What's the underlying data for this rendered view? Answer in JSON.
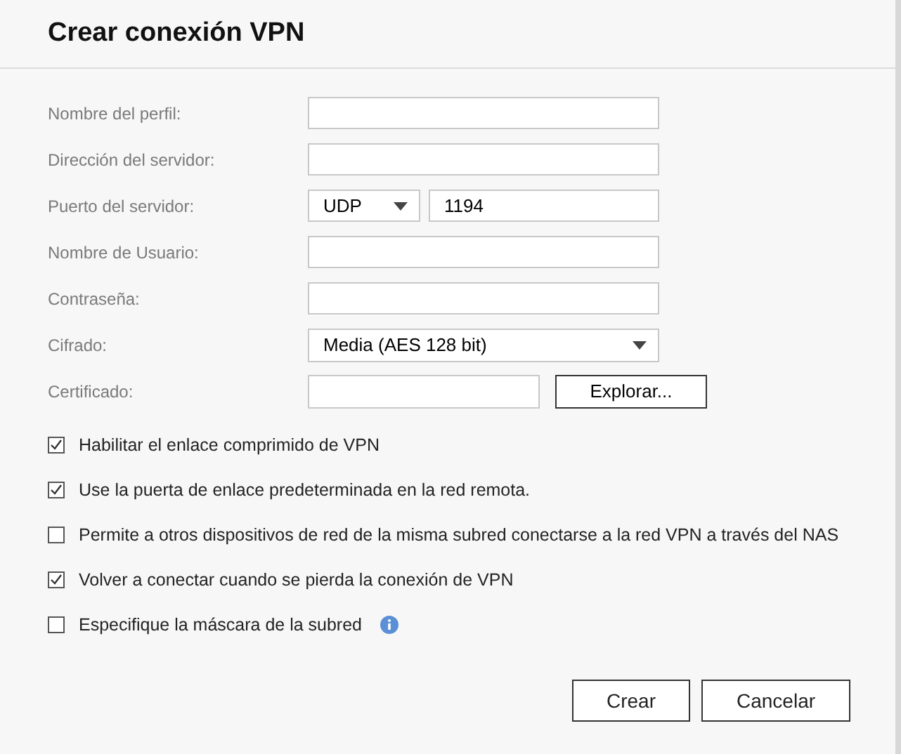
{
  "dialog": {
    "title": "Crear conexión VPN"
  },
  "fields": [
    {
      "kind": "text",
      "label": "Nombre del perfil:"
    },
    {
      "kind": "text",
      "label": "Dirección del servidor:"
    },
    {
      "kind": "port",
      "label": "Puerto del servidor:",
      "protocol": "UDP",
      "port": "1194"
    },
    {
      "kind": "text",
      "label": "Nombre de Usuario:"
    },
    {
      "kind": "text",
      "label": "Contraseña:"
    },
    {
      "kind": "select",
      "label": "Cifrado:",
      "value": "Media (AES 128 bit)"
    },
    {
      "kind": "file",
      "label": "Certificado:",
      "button": "Explorar..."
    }
  ],
  "options": [
    {
      "label": "Habilitar el enlace comprimido de VPN",
      "checked": true,
      "info": false
    },
    {
      "label": "Use la puerta de enlace predeterminada en la red remota.",
      "checked": true,
      "info": false
    },
    {
      "label": "Permite a otros dispositivos de red de la misma subred conectarse a la red VPN a través del NAS",
      "checked": false,
      "info": false
    },
    {
      "label": "Volver a conectar cuando se pierda la conexión de VPN",
      "checked": true,
      "info": false
    },
    {
      "label": "Especifique la máscara de la subred",
      "checked": false,
      "info": true
    }
  ],
  "buttons": [
    "Crear",
    "Cancelar"
  ]
}
